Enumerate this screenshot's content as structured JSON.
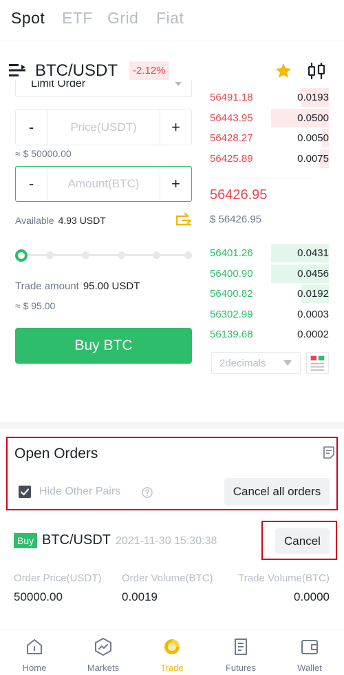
{
  "top_tabs": [
    "Spot",
    "ETF",
    "Grid",
    "Fiat"
  ],
  "pair": {
    "name": "BTC/USDT",
    "change": "-2.12%"
  },
  "form": {
    "order_type": "Limit Order",
    "price_placeholder": "Price(USDT)",
    "price_approx": "≈ $ 50000.00",
    "amount_placeholder": "Amount(BTC)",
    "minus": "-",
    "plus": "+",
    "available_label": "Available",
    "available_value": "4.93 USDT",
    "slider_percent": 0,
    "trade_amount_label": "Trade amount",
    "trade_amount_value": "95.00 USDT",
    "trade_amount_approx": "≈ $ 95.00",
    "buy_label": "Buy BTC"
  },
  "order_book": {
    "asks": [
      {
        "price": "56491.18",
        "qty": "0.0193",
        "depth": 0.48
      },
      {
        "price": "56443.95",
        "qty": "0.0500",
        "depth": 1.0
      },
      {
        "price": "56428.27",
        "qty": "0.0050",
        "depth": 0.12
      },
      {
        "price": "56425.89",
        "qty": "0.0075",
        "depth": 0.16
      }
    ],
    "mid_price": "56426.95",
    "mid_fiat": "$ 56426.95",
    "bids": [
      {
        "price": "56401.26",
        "qty": "0.0431",
        "depth": 1.0
      },
      {
        "price": "56400.90",
        "qty": "0.0456",
        "depth": 1.0
      },
      {
        "price": "56400.82",
        "qty": "0.0192",
        "depth": 0.48
      },
      {
        "price": "56302.99",
        "qty": "0.0003",
        "depth": 0.0
      },
      {
        "price": "56139.68",
        "qty": "0.0002",
        "depth": 0.0
      }
    ],
    "decimals": "2decimals"
  },
  "open_orders": {
    "title": "Open Orders",
    "hide_other_pairs": "Hide Other Pairs",
    "hide_checked": true,
    "cancel_all": "Cancel all orders",
    "order": {
      "side": "Buy",
      "pair": "BTC/USDT",
      "time": "2021-11-30 15:30:38",
      "cancel": "Cancel",
      "columns": [
        {
          "label": "Order Price(USDT)",
          "value": "50000.00"
        },
        {
          "label": "Order Volume(BTC)",
          "value": "0.0019"
        },
        {
          "label": "Trade Volume(BTC)",
          "value": "0.0000"
        }
      ]
    }
  },
  "bottom_nav": [
    {
      "label": "Home",
      "icon": "home-icon"
    },
    {
      "label": "Markets",
      "icon": "markets-icon"
    },
    {
      "label": "Trade",
      "icon": "trade-icon",
      "active": true
    },
    {
      "label": "Futures",
      "icon": "futures-icon"
    },
    {
      "label": "Wallet",
      "icon": "wallet-icon"
    }
  ],
  "colors": {
    "green": "#2ebd6b",
    "red": "#e8464f",
    "accent": "#f0b90b",
    "highlight_box": "#d0021b"
  }
}
